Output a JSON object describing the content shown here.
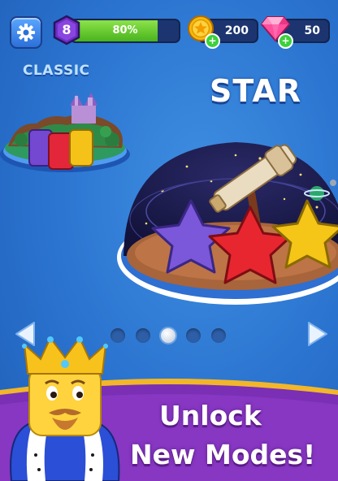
{
  "hud": {
    "level_number": "8",
    "xp_progress_label": "80%",
    "xp_progress": 0.8,
    "coins": "200",
    "gems": "50",
    "plus_symbol": "+",
    "icons": [
      "gear-icon",
      "coin-icon",
      "gem-icon",
      "plus-icon"
    ]
  },
  "modes": {
    "classic_label": "CLASSIC",
    "star_label": "STAR",
    "pages": 5,
    "active_page": 3
  },
  "promo": {
    "line1": "Unlock",
    "line2": "New Modes!"
  },
  "colors": {
    "background": "#2a73cf",
    "xp_fill": "#49b31c",
    "banner": "#7a2fb5",
    "banner_border": "#f2b62a",
    "star_purple": "#7b57d9",
    "star_red": "#e8262f",
    "star_yellow": "#f5c518"
  }
}
